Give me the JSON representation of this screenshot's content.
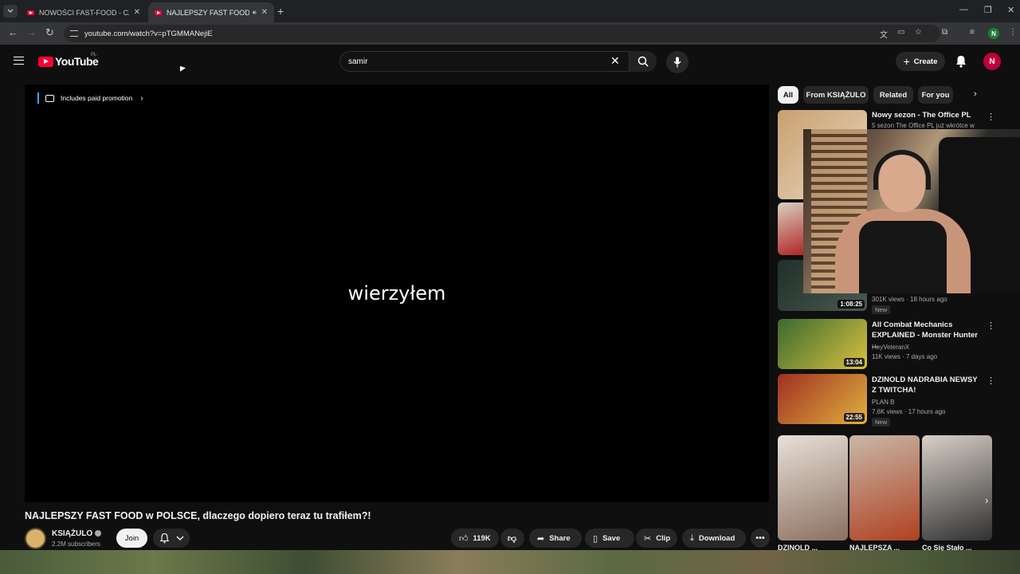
{
  "browser": {
    "tabs": [
      {
        "title": "NOWOŚCI FAST-FOOD - CZY W",
        "active": false
      },
      {
        "title": "NAJLEPSZY FAST FOOD w P",
        "active": true
      }
    ],
    "url": "youtube.com/watch?v=pTGMMANejiE",
    "profile_initial": "N"
  },
  "header": {
    "logo_text": "YouTube",
    "country_code": "PL",
    "search_value": "samir",
    "create_label": "Create",
    "avatar_initial": "N"
  },
  "player": {
    "promo_label": "Includes paid promotion",
    "caption": "wierzyłem"
  },
  "video": {
    "title": "NAJLEPSZY FAST FOOD w POLSCE, dlaczego dopiero teraz tu trafiłem?!",
    "channel": "KSIĄŻULO",
    "subscribers": "2.2M subscribers",
    "join_label": "Join",
    "likes": "119K",
    "share_label": "Share",
    "save_label": "Save",
    "clip_label": "Clip",
    "download_label": "Download"
  },
  "sidebar": {
    "chips": [
      "All",
      "From KSIĄŻULO",
      "Related",
      "For you"
    ],
    "recommendations": [
      {
        "title": "Nowy sezon - The Office PL",
        "channel": "5 sezon The Office PL już wkrótce w",
        "meta": "",
        "duration": "",
        "thumb_colors": [
          "#c9a070",
          "#e8d8c0"
        ]
      },
      {
        "title": "",
        "channel": "",
        "meta": "",
        "duration": "",
        "thumb_colors": [
          "#d8d0c0",
          "#b02020"
        ]
      },
      {
        "title": "",
        "channel": "",
        "meta": "301K views · 18 hours ago",
        "badge": "New",
        "duration": "1:08:25",
        "thumb_colors": [
          "#20302a",
          "#4a5a50"
        ]
      },
      {
        "title": "All Combat Mechanics EXPLAINED - Monster Hunter ...",
        "channel": "HeyVeteranX",
        "meta": "11K views · 7 days ago",
        "duration": "13:04",
        "thumb_colors": [
          "#3a6a30",
          "#d8c040"
        ]
      },
      {
        "title": "DZINOLD NADRABIA NEWSY Z TWITCHA!",
        "channel": "PLAN B",
        "meta": "7.6K views · 17 hours ago",
        "badge": "New",
        "duration": "22:55",
        "thumb_colors": [
          "#a03020",
          "#e0b040"
        ]
      }
    ],
    "shorts": [
      "DZINOLD ...",
      "NAJLEPSZA ...",
      "Co Się Stało ..."
    ]
  },
  "colors": {
    "brand_red": "#ff0033",
    "background": "#0f0f0f",
    "chip_bg": "#272727"
  }
}
